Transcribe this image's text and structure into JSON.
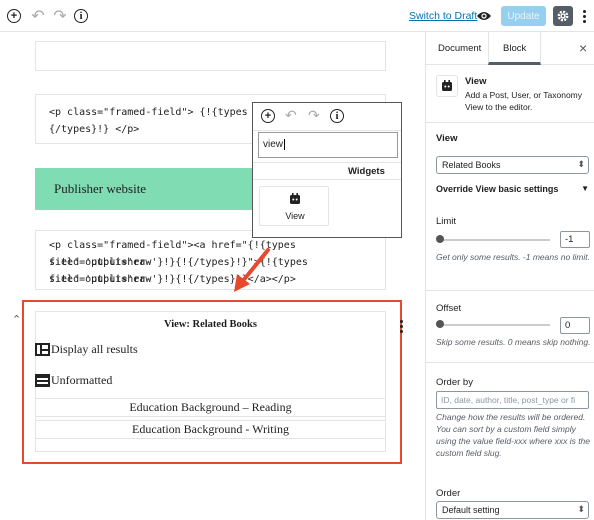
{
  "toolbar": {
    "switch_to_draft": "Switch to Draft",
    "update": "Update",
    "add_icon": "+",
    "info_icon": "i"
  },
  "editor": {
    "code_block_1": {
      "line1": "<p class=\"framed-field\"> {!{types fiel",
      "line2": "{/types}!} </p>"
    },
    "publisher_heading": "Publisher website",
    "code_block_2": {
      "line1": "<p class=\"framed-field\"><a href=\"{!{types field='publisher-",
      "line2": "site' output='raw'}!}{!{/types}!}\">{!{types field='publisher-",
      "line3": "site' output='raw'}!}{!{/types}!}</a></p>"
    },
    "view_block": {
      "title": "View: Related Books",
      "display_all": "Display all results",
      "unformatted": "Unformatted",
      "items": [
        "Education Background – Reading",
        "Education Background - Writing"
      ]
    }
  },
  "inserter": {
    "search_value": "view",
    "category": "Widgets",
    "tile_label": "View"
  },
  "sidebar": {
    "tabs": [
      "Document",
      "Block"
    ],
    "active_tab": "Block",
    "close": "×",
    "block_name": "View",
    "block_description": "Add a Post, User, or Taxonomy View to the editor.",
    "view_label": "View",
    "view_selected": "Related Books",
    "override_label": "Override View basic settings",
    "limit_label": "Limit",
    "limit_value": "-1",
    "limit_help": "Get only some results. -1 means no limit.",
    "offset_label": "Offset",
    "offset_value": "0",
    "offset_help": "Skip some results. 0 means skip nothing.",
    "order_by_label": "Order by",
    "order_by_placeholder": "ID, date, author, title, post_type or fi",
    "order_by_help": "Change how the results will be ordered. You can sort by a custom field simply using the value field-xxx where xxx is the custom field slug.",
    "order_label": "Order",
    "order_selected": "Default setting"
  },
  "colors": {
    "accent": "#0073aa",
    "highlight_red": "#e8482c",
    "heading_bg": "#7fdcb3"
  }
}
